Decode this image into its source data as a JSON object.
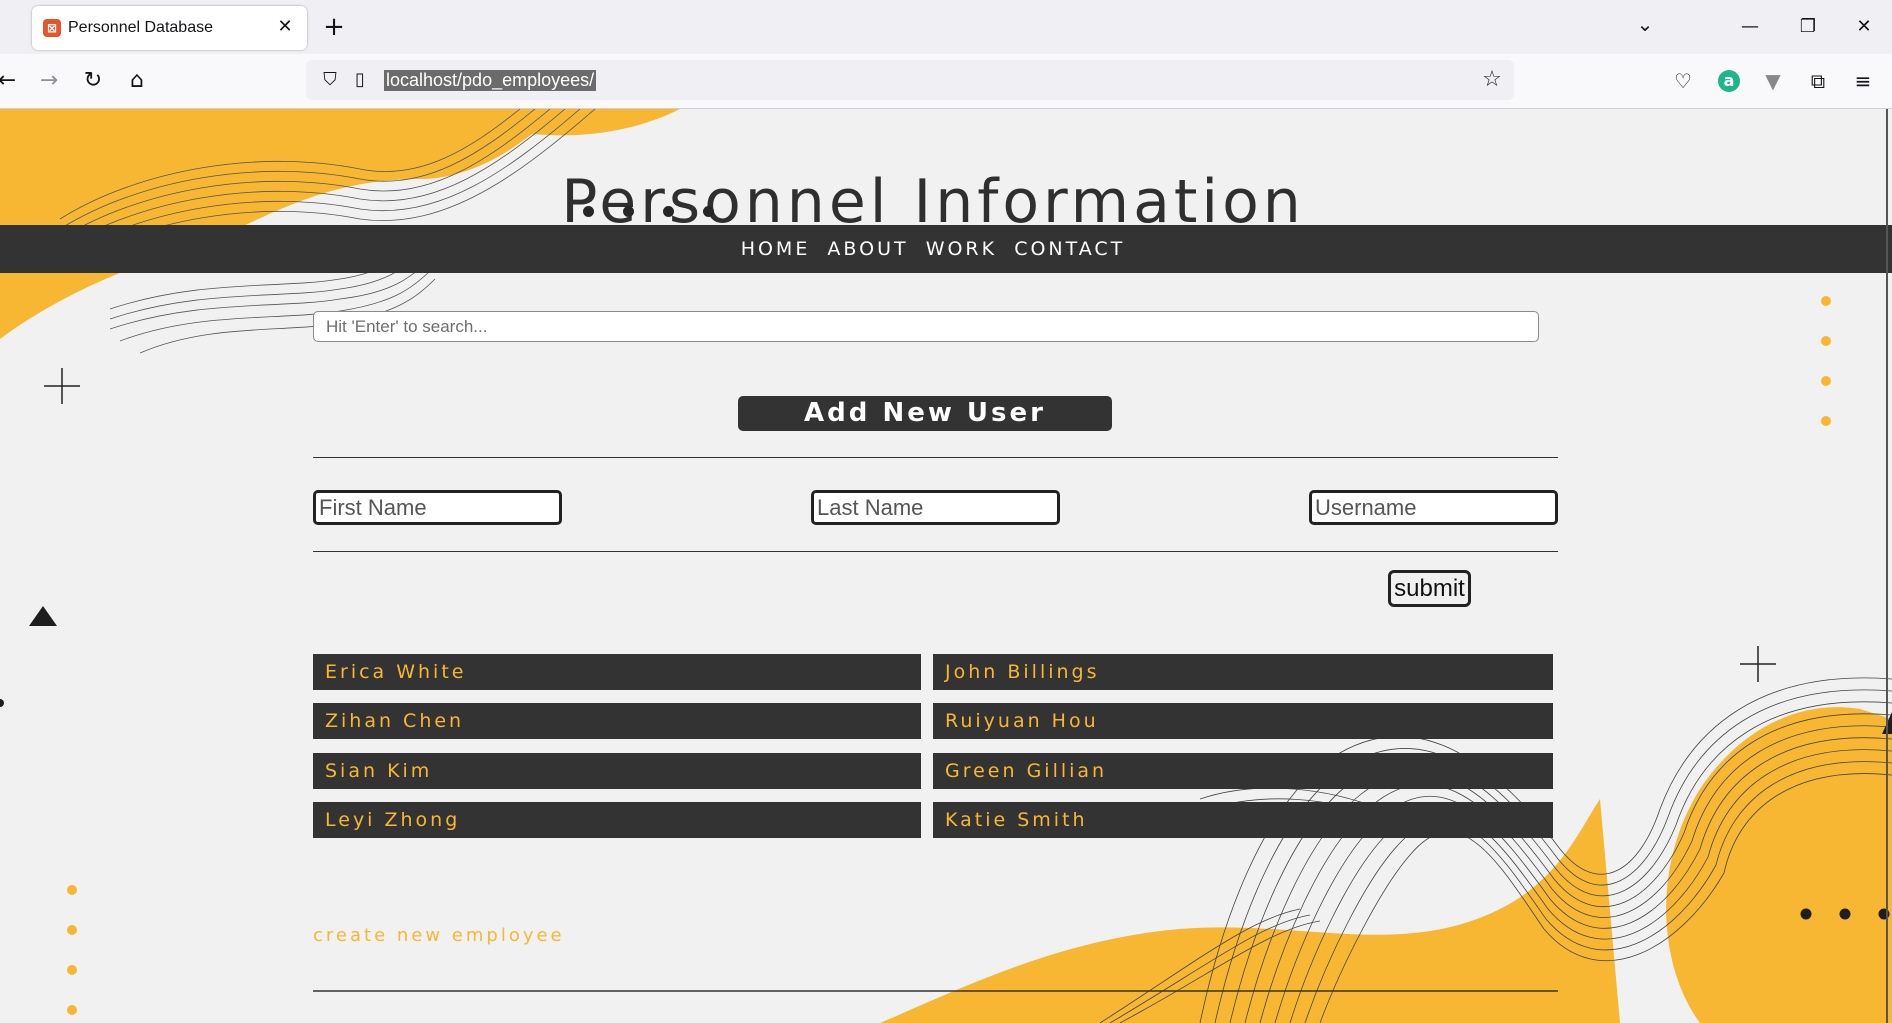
{
  "browser": {
    "tab_title": "Personnel Database",
    "tab_close": "✕",
    "new_tab": "+",
    "tab_list": "⌄",
    "url": "localhost/pdo_employees/",
    "window": {
      "minimize": "—",
      "restore": "❐",
      "close": "✕"
    },
    "icons": [
      "back-icon",
      "forward-icon",
      "reload-icon",
      "home-icon",
      "shield-icon",
      "page-icon",
      "star-icon",
      "pocket-icon",
      "extension-a-icon",
      "vpn-icon",
      "extensions-icon",
      "menu-icon"
    ]
  },
  "header": {
    "title": "Personnel Information"
  },
  "nav": {
    "items": [
      "HOME",
      "ABOUT",
      "WORK",
      "CONTACT"
    ]
  },
  "search": {
    "placeholder": "Hit 'Enter' to search..."
  },
  "add_user": {
    "title": "Add New User",
    "first_name_placeholder": "First Name",
    "last_name_placeholder": "Last Name",
    "username_placeholder": "Username",
    "submit_label": "submit"
  },
  "employees": [
    "Erica White",
    "John Billings",
    "Zihan Chen",
    "Ruiyuan Hou",
    "Sian Kim",
    "Green Gillian",
    "Leyi Zhong",
    "Katie Smith"
  ],
  "footer": {
    "create_link": "create new employee"
  },
  "colors": {
    "accent": "#f7b733",
    "dark": "#333333",
    "background": "#f1f1f1"
  }
}
